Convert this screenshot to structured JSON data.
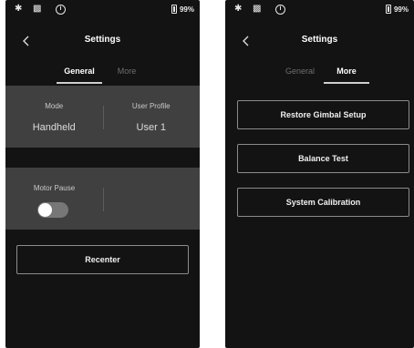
{
  "left_screen": {
    "status": {
      "battery": "99%"
    },
    "header": {
      "title": "Settings"
    },
    "tabs": [
      {
        "label": "General",
        "active": true
      },
      {
        "label": "More",
        "active": false
      }
    ],
    "mode": {
      "label": "Mode",
      "value": "Handheld"
    },
    "user_profile": {
      "label": "User Profile",
      "value": "User 1"
    },
    "motor_pause": {
      "label": "Motor Pause",
      "enabled": false
    },
    "recenter_label": "Recenter"
  },
  "right_screen": {
    "status": {
      "battery": "99%"
    },
    "header": {
      "title": "Settings"
    },
    "tabs": [
      {
        "label": "General",
        "active": false
      },
      {
        "label": "More",
        "active": true
      }
    ],
    "buttons": {
      "restore": "Restore Gimbal Setup",
      "balance": "Balance Test",
      "calibration": "System Calibration"
    }
  },
  "icons": {
    "bluetooth": "bluetooth-icon",
    "gimbal": "gimbal-icon",
    "info": "info-icon",
    "battery": "battery-icon",
    "back": "chevron-left-icon"
  },
  "colors": {
    "background": "#131313",
    "panel": "#404040",
    "accent": "#ffffff",
    "inactive_tab": "#6e6e6e"
  }
}
